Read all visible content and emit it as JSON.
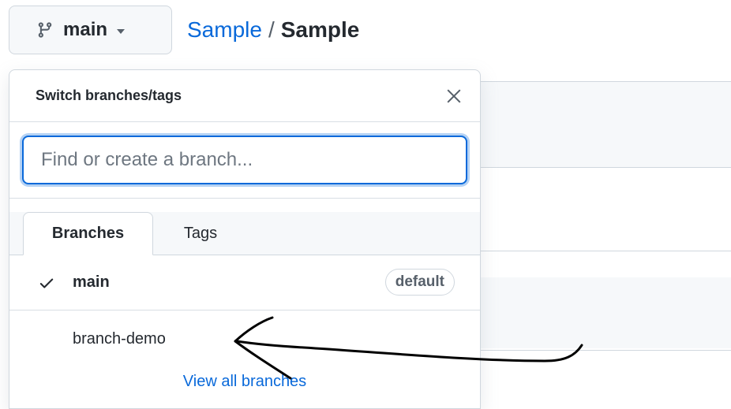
{
  "branch_button": {
    "label": "main",
    "icon": "git-branch-icon"
  },
  "breadcrumb": {
    "owner": "Sample",
    "separator": "/",
    "repo": "Sample"
  },
  "dropdown": {
    "title": "Switch branches/tags",
    "close_icon": "close-icon",
    "filter": {
      "placeholder": "Find or create a branch...",
      "value": ""
    },
    "tabs": [
      {
        "label": "Branches",
        "selected": true
      },
      {
        "label": "Tags",
        "selected": false
      }
    ],
    "branches": [
      {
        "name": "main",
        "current": true,
        "badge": "default"
      },
      {
        "name": "branch-demo",
        "current": false,
        "badge": ""
      }
    ],
    "view_all_label": "View all branches"
  },
  "colors": {
    "accent": "#0969da",
    "border": "#d0d7de",
    "text": "#24292f",
    "muted": "#57606a"
  }
}
